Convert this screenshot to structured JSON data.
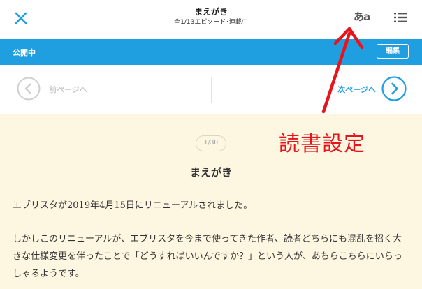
{
  "header": {
    "close_icon": "close-icon",
    "title": "まえがき",
    "subtitle": "全1/13エピソード･連載中",
    "font_button_label": "あa",
    "menu_icon": "list-menu-icon"
  },
  "status": {
    "label": "公開中",
    "edit_label": "編集"
  },
  "navigation": {
    "prev_label": "前ページへ",
    "next_label": "次ページへ"
  },
  "content": {
    "page_indicator": "1/30",
    "chapter_title": "まえがき",
    "paragraphs": [
      "エブリスタが2019年4月15日にリニューアルされました。",
      "しかしこのリニューアルが、エブリスタを今まで使ってきた作者、読者どちらにも混乱を招く大きな仕様変更を伴ったことで「どうすればいいんですか？」という人が、あちらこちらにいらっしゃるようです。"
    ]
  },
  "annotation": {
    "text": "読書設定",
    "color": "#e8141b"
  },
  "colors": {
    "accent": "#1f9ee0",
    "reading_background": "#fdf7e1"
  }
}
